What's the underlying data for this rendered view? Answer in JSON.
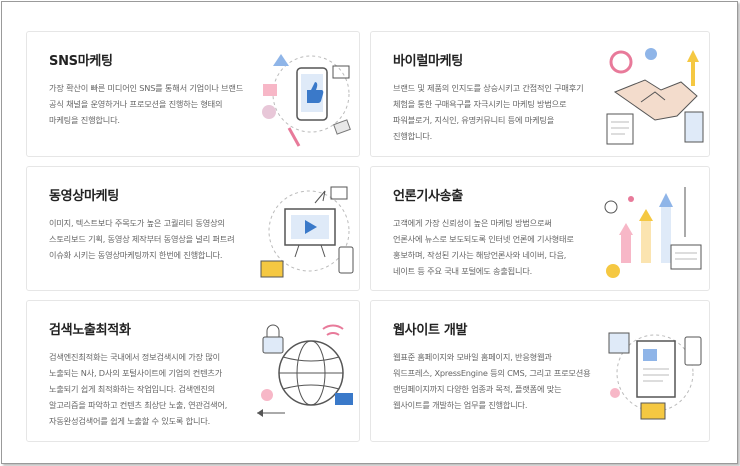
{
  "services": [
    {
      "title": "SNS마케팅",
      "desc": [
        "가장 확산이 빠른 미디어인 SNS를 통해서 기업이나 브랜드",
        "공식 채널을 운영하거나 프로모션을 진행하는 형태의",
        "마케팅을 진행합니다."
      ],
      "icon": "sns-illustration-icon"
    },
    {
      "title": "바이럴마케팅",
      "desc": [
        "브랜드 및 제품의 인지도를 상승시키고 간접적인 구매후기",
        "체험을 통한 구매욕구를 자극시키는 마케팅 방법으로",
        "파워블로거, 지식인, 유명커뮤니티 등에 마케팅을",
        "진행합니다."
      ],
      "icon": "handshake-illustration-icon"
    },
    {
      "title": "동영상마케팅",
      "desc": [
        "이미지, 텍스트보다 주목도가 높은 고퀄리티 동영상의",
        "스토리보드 기획, 동영상 제작부터 동영상을 널리 퍼트려",
        "이슈화 시키는 동영상마케팅까지 한번에 진행합니다."
      ],
      "icon": "video-illustration-icon"
    },
    {
      "title": "언론기사송출",
      "desc": [
        "고객에게 가장 신뢰성이 높은 마케팅 방법으로써",
        "언론사에 뉴스로 보도되도록 인터넷 언론에 기사형태로",
        "홍보하며, 작성된 기사는 해당언론사와 네이버, 다음,",
        "네이트 등 주요 국내 포털에도 송출됩니다."
      ],
      "icon": "growth-chart-illustration-icon"
    },
    {
      "title": "검색노출최적화",
      "desc": [
        "검색엔진최적화는 국내에서 정보검색시에 가장 많이",
        "노출되는 N사, D사의 포털사이트에 기업의 컨텐츠가",
        "노출되기 쉽게 최적화하는 작업입니다. 검색엔진의",
        "알고리즘을 파악하고 컨텐츠 최상단 노출, 연관검색어,",
        "자동완성검색어를 쉽게 노출할 수 있도록 합니다."
      ],
      "icon": "globe-illustration-icon"
    },
    {
      "title": "웹사이트 개발",
      "desc": [
        "웹표준 홈페이지와 모바일 홈페이지, 반응형웹과",
        "워드프레스, XpressEngine 등의 CMS, 그리고 프로모션용",
        "랜딩페이지까지 다양한 업종과 목적, 플랫폼에 맞는",
        "웹사이트를 개발하는 업무를 진행합니다."
      ],
      "icon": "website-document-illustration-icon"
    }
  ]
}
